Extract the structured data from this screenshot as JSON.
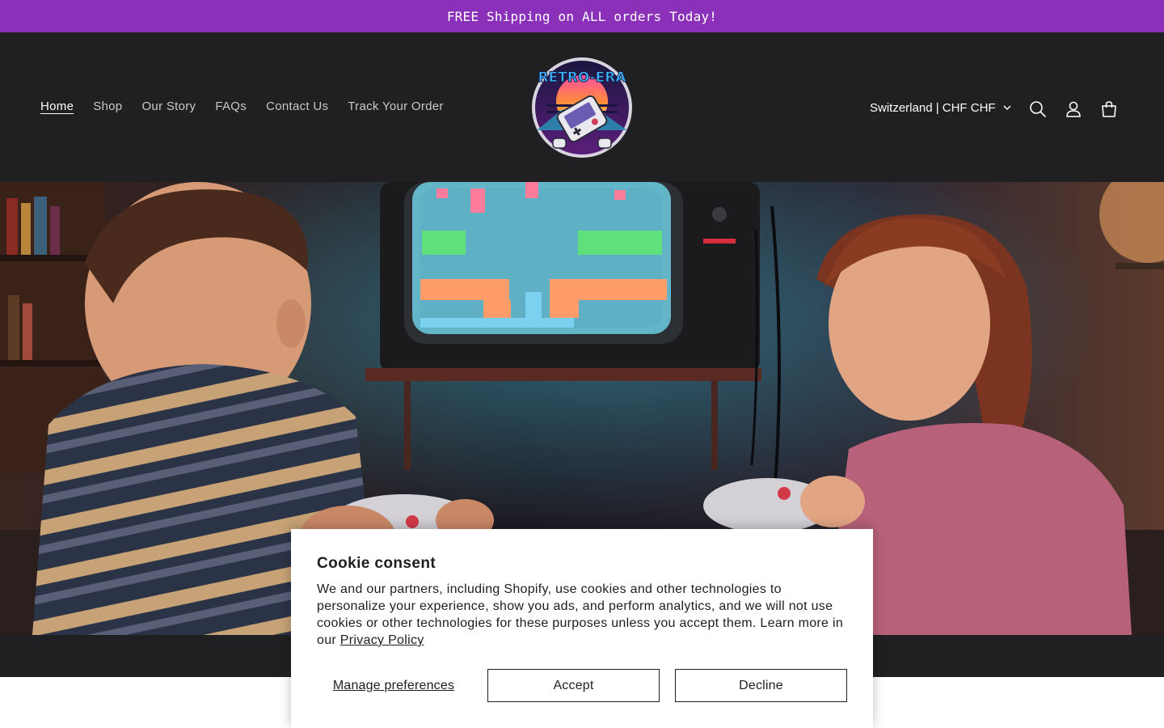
{
  "announcement": {
    "text": "FREE Shipping on ALL orders Today!"
  },
  "header": {
    "nav": [
      {
        "label": "Home",
        "active": true
      },
      {
        "label": "Shop"
      },
      {
        "label": "Our Story"
      },
      {
        "label": "FAQs"
      },
      {
        "label": "Contact Us"
      },
      {
        "label": "Track Your Order"
      }
    ],
    "logo": {
      "text": "RETRO-ERA",
      "icon": "gameboy-logo"
    },
    "country_selector": "Switzerland | CHF CHF",
    "icons": [
      "search-icon",
      "account-icon",
      "cart-icon"
    ]
  },
  "hero": {
    "image": "kids-playing-retro-game-console-photo"
  },
  "cookie_consent": {
    "title": "Cookie consent",
    "body": "We and our partners, including Shopify, use cookies and other technologies to personalize your experience, show you ads, and perform analytics, and we will not use cookies or other technologies for these purposes unless you accept them. Learn more in our ",
    "policy_link": "Privacy Policy",
    "manage_label": "Manage preferences",
    "accept_label": "Accept",
    "decline_label": "Decline"
  },
  "colors": {
    "announcement_bg": "#8b31b9",
    "header_bg": "#202022",
    "text_on_dark": "#ffffff"
  }
}
